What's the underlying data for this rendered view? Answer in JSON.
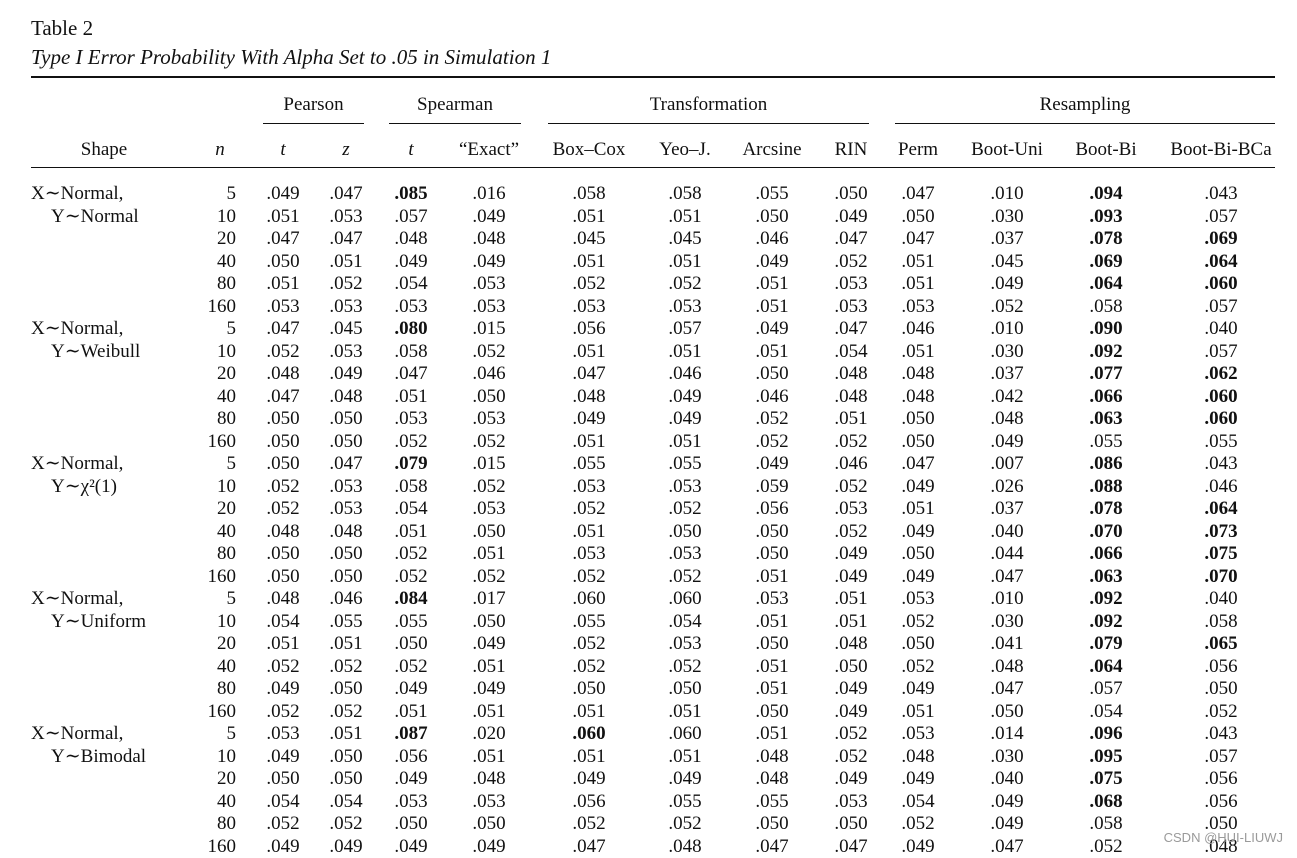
{
  "table_label": "Table 2",
  "table_title": "Type I Error Probability With Alpha Set to .05 in Simulation 1",
  "group_headers": [
    "Pearson",
    "Spearman",
    "Transformation",
    "Resampling"
  ],
  "column_headers": [
    "Shape",
    "n",
    "t",
    "z",
    "t",
    "“Exact”",
    "Box–Cox",
    "Yeo–J.",
    "Arcsine",
    "RIN",
    "Perm",
    "Boot-Uni",
    "Boot-Bi",
    "Boot-Bi-BCa"
  ],
  "shapes": [
    {
      "line1": "X∼Normal,",
      "line2": "Y∼Normal"
    },
    {
      "line1": "X∼Normal,",
      "line2": "Y∼Weibull"
    },
    {
      "line1": "X∼Normal,",
      "line2": "Y∼χ²(1)"
    },
    {
      "line1": "X∼Normal,",
      "line2": "Y∼Uniform"
    },
    {
      "line1": "X∼Normal,",
      "line2": "Y∼Bimodal"
    }
  ],
  "rows": [
    {
      "n": "5",
      "v": [
        ".049",
        ".047",
        ".085",
        ".016",
        ".058",
        ".058",
        ".055",
        ".050",
        ".047",
        ".010",
        ".094",
        ".043"
      ],
      "b": [
        2,
        10
      ]
    },
    {
      "n": "10",
      "v": [
        ".051",
        ".053",
        ".057",
        ".049",
        ".051",
        ".051",
        ".050",
        ".049",
        ".050",
        ".030",
        ".093",
        ".057"
      ],
      "b": [
        10
      ]
    },
    {
      "n": "20",
      "v": [
        ".047",
        ".047",
        ".048",
        ".048",
        ".045",
        ".045",
        ".046",
        ".047",
        ".047",
        ".037",
        ".078",
        ".069"
      ],
      "b": [
        10,
        11
      ]
    },
    {
      "n": "40",
      "v": [
        ".050",
        ".051",
        ".049",
        ".049",
        ".051",
        ".051",
        ".049",
        ".052",
        ".051",
        ".045",
        ".069",
        ".064"
      ],
      "b": [
        10,
        11
      ]
    },
    {
      "n": "80",
      "v": [
        ".051",
        ".052",
        ".054",
        ".053",
        ".052",
        ".052",
        ".051",
        ".053",
        ".051",
        ".049",
        ".064",
        ".060"
      ],
      "b": [
        10,
        11
      ]
    },
    {
      "n": "160",
      "v": [
        ".053",
        ".053",
        ".053",
        ".053",
        ".053",
        ".053",
        ".051",
        ".053",
        ".053",
        ".052",
        ".058",
        ".057"
      ],
      "b": []
    },
    {
      "n": "5",
      "v": [
        ".047",
        ".045",
        ".080",
        ".015",
        ".056",
        ".057",
        ".049",
        ".047",
        ".046",
        ".010",
        ".090",
        ".040"
      ],
      "b": [
        2,
        10
      ]
    },
    {
      "n": "10",
      "v": [
        ".052",
        ".053",
        ".058",
        ".052",
        ".051",
        ".051",
        ".051",
        ".054",
        ".051",
        ".030",
        ".092",
        ".057"
      ],
      "b": [
        10
      ]
    },
    {
      "n": "20",
      "v": [
        ".048",
        ".049",
        ".047",
        ".046",
        ".047",
        ".046",
        ".050",
        ".048",
        ".048",
        ".037",
        ".077",
        ".062"
      ],
      "b": [
        10,
        11
      ]
    },
    {
      "n": "40",
      "v": [
        ".047",
        ".048",
        ".051",
        ".050",
        ".048",
        ".049",
        ".046",
        ".048",
        ".048",
        ".042",
        ".066",
        ".060"
      ],
      "b": [
        10,
        11
      ]
    },
    {
      "n": "80",
      "v": [
        ".050",
        ".050",
        ".053",
        ".053",
        ".049",
        ".049",
        ".052",
        ".051",
        ".050",
        ".048",
        ".063",
        ".060"
      ],
      "b": [
        10,
        11
      ]
    },
    {
      "n": "160",
      "v": [
        ".050",
        ".050",
        ".052",
        ".052",
        ".051",
        ".051",
        ".052",
        ".052",
        ".050",
        ".049",
        ".055",
        ".055"
      ],
      "b": []
    },
    {
      "n": "5",
      "v": [
        ".050",
        ".047",
        ".079",
        ".015",
        ".055",
        ".055",
        ".049",
        ".046",
        ".047",
        ".007",
        ".086",
        ".043"
      ],
      "b": [
        2,
        10
      ]
    },
    {
      "n": "10",
      "v": [
        ".052",
        ".053",
        ".058",
        ".052",
        ".053",
        ".053",
        ".059",
        ".052",
        ".049",
        ".026",
        ".088",
        ".046"
      ],
      "b": [
        10
      ]
    },
    {
      "n": "20",
      "v": [
        ".052",
        ".053",
        ".054",
        ".053",
        ".052",
        ".052",
        ".056",
        ".053",
        ".051",
        ".037",
        ".078",
        ".064"
      ],
      "b": [
        10,
        11
      ]
    },
    {
      "n": "40",
      "v": [
        ".048",
        ".048",
        ".051",
        ".050",
        ".051",
        ".050",
        ".050",
        ".052",
        ".049",
        ".040",
        ".070",
        ".073"
      ],
      "b": [
        10,
        11
      ]
    },
    {
      "n": "80",
      "v": [
        ".050",
        ".050",
        ".052",
        ".051",
        ".053",
        ".053",
        ".050",
        ".049",
        ".050",
        ".044",
        ".066",
        ".075"
      ],
      "b": [
        10,
        11
      ]
    },
    {
      "n": "160",
      "v": [
        ".050",
        ".050",
        ".052",
        ".052",
        ".052",
        ".052",
        ".051",
        ".049",
        ".049",
        ".047",
        ".063",
        ".070"
      ],
      "b": [
        10,
        11
      ]
    },
    {
      "n": "5",
      "v": [
        ".048",
        ".046",
        ".084",
        ".017",
        ".060",
        ".060",
        ".053",
        ".051",
        ".053",
        ".010",
        ".092",
        ".040"
      ],
      "b": [
        2,
        10
      ]
    },
    {
      "n": "10",
      "v": [
        ".054",
        ".055",
        ".055",
        ".050",
        ".055",
        ".054",
        ".051",
        ".051",
        ".052",
        ".030",
        ".092",
        ".058"
      ],
      "b": [
        10
      ]
    },
    {
      "n": "20",
      "v": [
        ".051",
        ".051",
        ".050",
        ".049",
        ".052",
        ".053",
        ".050",
        ".048",
        ".050",
        ".041",
        ".079",
        ".065"
      ],
      "b": [
        10,
        11
      ]
    },
    {
      "n": "40",
      "v": [
        ".052",
        ".052",
        ".052",
        ".051",
        ".052",
        ".052",
        ".051",
        ".050",
        ".052",
        ".048",
        ".064",
        ".056"
      ],
      "b": [
        10
      ]
    },
    {
      "n": "80",
      "v": [
        ".049",
        ".050",
        ".049",
        ".049",
        ".050",
        ".050",
        ".051",
        ".049",
        ".049",
        ".047",
        ".057",
        ".050"
      ],
      "b": []
    },
    {
      "n": "160",
      "v": [
        ".052",
        ".052",
        ".051",
        ".051",
        ".051",
        ".051",
        ".050",
        ".049",
        ".051",
        ".050",
        ".054",
        ".052"
      ],
      "b": []
    },
    {
      "n": "5",
      "v": [
        ".053",
        ".051",
        ".087",
        ".020",
        ".060",
        ".060",
        ".051",
        ".052",
        ".053",
        ".014",
        ".096",
        ".043"
      ],
      "b": [
        2,
        4,
        10
      ]
    },
    {
      "n": "10",
      "v": [
        ".049",
        ".050",
        ".056",
        ".051",
        ".051",
        ".051",
        ".048",
        ".052",
        ".048",
        ".030",
        ".095",
        ".057"
      ],
      "b": [
        10
      ]
    },
    {
      "n": "20",
      "v": [
        ".050",
        ".050",
        ".049",
        ".048",
        ".049",
        ".049",
        ".048",
        ".049",
        ".049",
        ".040",
        ".075",
        ".056"
      ],
      "b": [
        10
      ]
    },
    {
      "n": "40",
      "v": [
        ".054",
        ".054",
        ".053",
        ".053",
        ".056",
        ".055",
        ".055",
        ".053",
        ".054",
        ".049",
        ".068",
        ".056"
      ],
      "b": [
        10
      ]
    },
    {
      "n": "80",
      "v": [
        ".052",
        ".052",
        ".050",
        ".050",
        ".052",
        ".052",
        ".050",
        ".050",
        ".052",
        ".049",
        ".058",
        ".050"
      ],
      "b": []
    },
    {
      "n": "160",
      "v": [
        ".049",
        ".049",
        ".049",
        ".049",
        ".047",
        ".048",
        ".047",
        ".047",
        ".049",
        ".047",
        ".052",
        ".048"
      ],
      "b": []
    }
  ],
  "watermark": "CSDN @HUI-LIUWJ"
}
